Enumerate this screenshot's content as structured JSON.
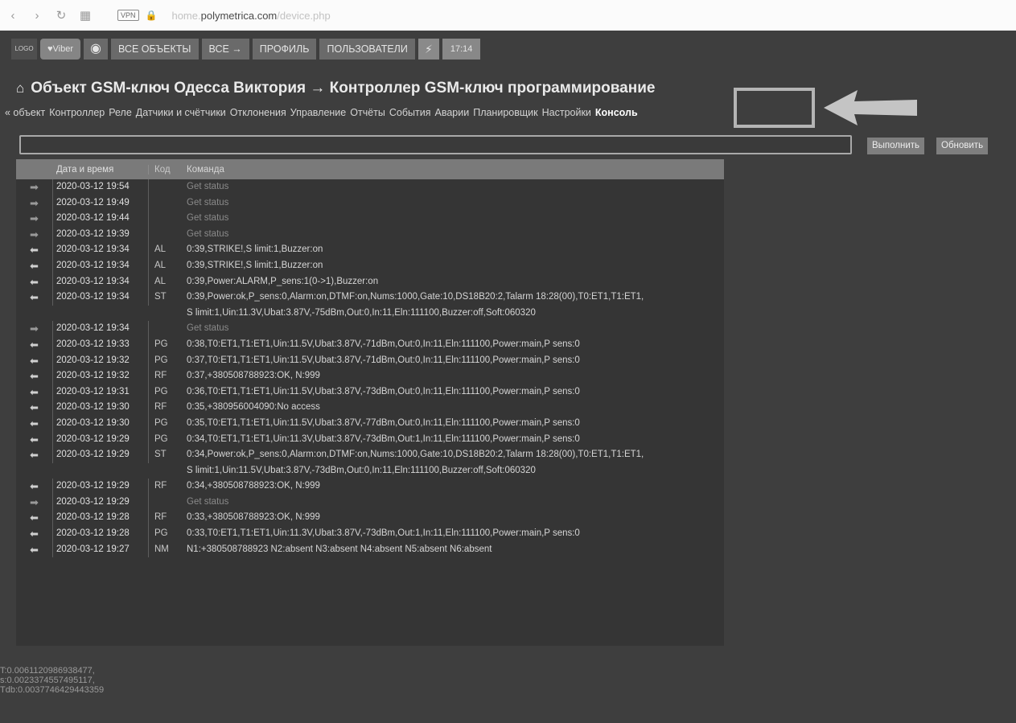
{
  "browser": {
    "back": "‹",
    "forward": "›",
    "reload": "↻",
    "grid": "▦",
    "vpn": "VPN",
    "url_prefix": "home.",
    "url_domain": "polymetrica.com",
    "url_path": "/device.php"
  },
  "topbar": {
    "logo": "LOGO",
    "viber": "♥Viber",
    "objects": "ВСЕ ОБЪЕКТЫ",
    "all": "ВСЕ →",
    "profile": "ПРОФИЛЬ",
    "users": "ПОЛЬЗОВАТЕЛИ",
    "time": "17:14"
  },
  "title": "Объект GSM-ключ Одесса Виктория → Контроллер GSM-ключ программирование",
  "navlinks": [
    "« объект",
    "Контроллер",
    "Реле",
    "Датчики и счётчики",
    "Отклонения",
    "Управление",
    "Отчёты",
    "События",
    "Аварии",
    "Планировщик",
    "Настройки"
  ],
  "active_nav": "Консоль",
  "command_input": {
    "value": "",
    "placeholder": ""
  },
  "buttons": {
    "run": "Выполнить",
    "refresh": "Обновить"
  },
  "table": {
    "headers": [
      "",
      "Дата и время",
      "Код",
      "Команда"
    ],
    "rows": [
      {
        "dir": "out",
        "datetime": "2020-03-12 19:54",
        "code": "",
        "lines": [
          "Get status"
        ]
      },
      {
        "dir": "out",
        "datetime": "2020-03-12 19:49",
        "code": "",
        "lines": [
          "Get status"
        ]
      },
      {
        "dir": "out",
        "datetime": "2020-03-12 19:44",
        "code": "",
        "lines": [
          "Get status"
        ]
      },
      {
        "dir": "out",
        "datetime": "2020-03-12 19:39",
        "code": "",
        "lines": [
          "Get status"
        ]
      },
      {
        "dir": "in",
        "datetime": "2020-03-12 19:34",
        "code": "AL",
        "lines": [
          "0:39,STRIKE!,S limit:1,Buzzer:on"
        ]
      },
      {
        "dir": "in",
        "datetime": "2020-03-12 19:34",
        "code": "AL",
        "lines": [
          "0:39,STRIKE!,S limit:1,Buzzer:on"
        ]
      },
      {
        "dir": "in",
        "datetime": "2020-03-12 19:34",
        "code": "AL",
        "lines": [
          "0:39,Power:ALARM,P_sens:1(0->1),Buzzer:on"
        ]
      },
      {
        "dir": "in",
        "datetime": "2020-03-12 19:34",
        "code": "ST",
        "lines": [
          "0:39,Power:ok,P_sens:0,Alarm:on,DTMF:on,Nums:1000,Gate:10,DS18B20:2,Talarm 18:28(00),T0:ET1,T1:ET1,",
          "S limit:1,Uin:11.3V,Ubat:3.87V,-75dBm,Out:0,In:11,Eln:111100,Buzzer:off,Soft:060320"
        ]
      },
      {
        "dir": "out",
        "datetime": "2020-03-12 19:34",
        "code": "",
        "lines": [
          "Get status"
        ]
      },
      {
        "dir": "in",
        "datetime": "2020-03-12 19:33",
        "code": "PG",
        "lines": [
          "0:38,T0:ET1,T1:ET1,Uin:11.5V,Ubat:3.87V,-71dBm,Out:0,In:11,Eln:111100,Power:main,P sens:0"
        ]
      },
      {
        "dir": "in",
        "datetime": "2020-03-12 19:32",
        "code": "PG",
        "lines": [
          "0:37,T0:ET1,T1:ET1,Uin:11.5V,Ubat:3.87V,-71dBm,Out:0,In:11,Eln:111100,Power:main,P sens:0"
        ]
      },
      {
        "dir": "in",
        "datetime": "2020-03-12 19:32",
        "code": "RF",
        "lines": [
          "0:37,+380508788923:OK, N:999"
        ]
      },
      {
        "dir": "in",
        "datetime": "2020-03-12 19:31",
        "code": "PG",
        "lines": [
          "0:36,T0:ET1,T1:ET1,Uin:11.5V,Ubat:3.87V,-73dBm,Out:0,In:11,Eln:111100,Power:main,P sens:0"
        ]
      },
      {
        "dir": "in",
        "datetime": "2020-03-12 19:30",
        "code": "RF",
        "lines": [
          "0:35,+380956004090:No access"
        ]
      },
      {
        "dir": "in",
        "datetime": "2020-03-12 19:30",
        "code": "PG",
        "lines": [
          "0:35,T0:ET1,T1:ET1,Uin:11.5V,Ubat:3.87V,-77dBm,Out:0,In:11,Eln:111100,Power:main,P sens:0"
        ]
      },
      {
        "dir": "in",
        "datetime": "2020-03-12 19:29",
        "code": "PG",
        "lines": [
          "0:34,T0:ET1,T1:ET1,Uin:11.3V,Ubat:3.87V,-73dBm,Out:1,In:11,Eln:111100,Power:main,P sens:0"
        ]
      },
      {
        "dir": "in",
        "datetime": "2020-03-12 19:29",
        "code": "ST",
        "lines": [
          "0:34,Power:ok,P_sens:0,Alarm:on,DTMF:on,Nums:1000,Gate:10,DS18B20:2,Talarm 18:28(00),T0:ET1,T1:ET1,",
          "S limit:1,Uin:11.5V,Ubat:3.87V,-73dBm,Out:0,In:11,Eln:111100,Buzzer:off,Soft:060320"
        ]
      },
      {
        "dir": "in",
        "datetime": "2020-03-12 19:29",
        "code": "RF",
        "lines": [
          "0:34,+380508788923:OK, N:999"
        ]
      },
      {
        "dir": "out",
        "datetime": "2020-03-12 19:29",
        "code": "",
        "lines": [
          "Get status"
        ]
      },
      {
        "dir": "in",
        "datetime": "2020-03-12 19:28",
        "code": "RF",
        "lines": [
          "0:33,+380508788923:OK, N:999"
        ]
      },
      {
        "dir": "in",
        "datetime": "2020-03-12 19:28",
        "code": "PG",
        "lines": [
          "0:33,T0:ET1,T1:ET1,Uin:11.3V,Ubat:3.87V,-73dBm,Out:1,In:11,Eln:111100,Power:main,P sens:0"
        ]
      },
      {
        "dir": "in",
        "datetime": "2020-03-12 19:27",
        "code": "NM",
        "lines": [
          "N1:+380508788923 N2:absent N3:absent N4:absent N5:absent N6:absent"
        ]
      }
    ]
  },
  "stats": [
    "T:0.0061120986938477,",
    "s:0.0023374557495117,",
    "Tdb:0.0037746429443359"
  ]
}
